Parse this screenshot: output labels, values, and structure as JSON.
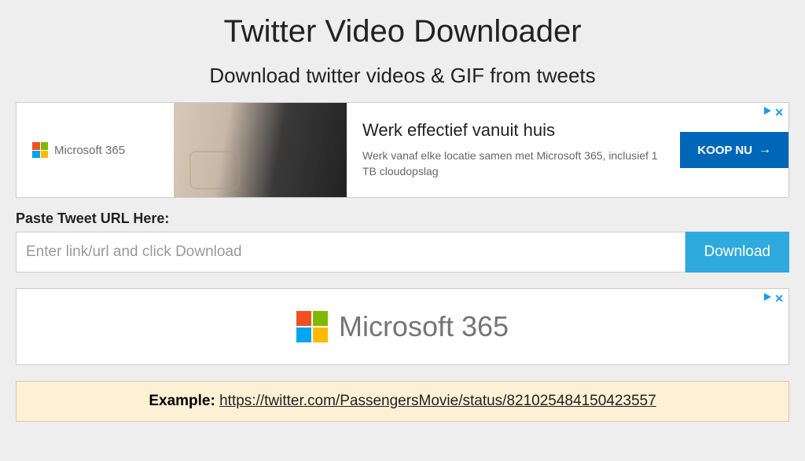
{
  "title": "Twitter Video Downloader",
  "subtitle": "Download twitter videos & GIF from tweets",
  "ad1": {
    "brand": "Microsoft 365",
    "headline": "Werk effectief vanuit huis",
    "sub": "Werk vanaf elke locatie samen met Microsoft 365, inclusief 1 TB cloudopslag",
    "cta": "KOOP NU"
  },
  "form": {
    "label": "Paste Tweet URL Here:",
    "placeholder": "Enter link/url and click Download",
    "button": "Download"
  },
  "ad2": {
    "brand": "Microsoft 365"
  },
  "example": {
    "label": "Example:",
    "url": "https://twitter.com/PassengersMovie/status/821025484150423557"
  }
}
